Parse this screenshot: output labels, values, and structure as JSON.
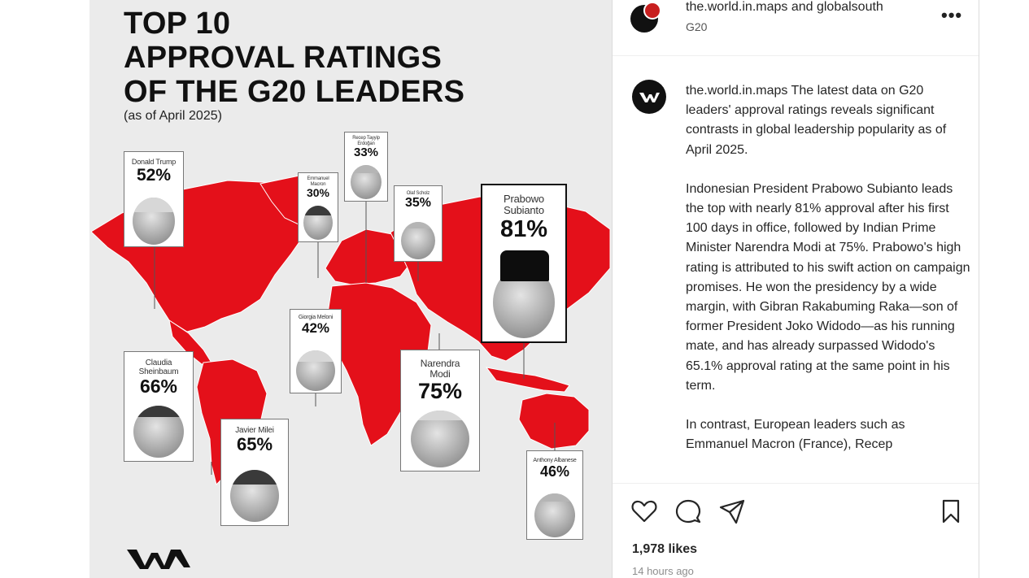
{
  "post": {
    "title_lines": [
      "TOP 10",
      "APPROVAL RATINGS",
      "OF THE G20 LEADERS"
    ],
    "subtitle": "(as of April 2025)",
    "map_color": "#e4101a",
    "leaders": [
      {
        "name": "Donald Trump",
        "pct": "52%"
      },
      {
        "name": "Emmanuel Macron",
        "pct": "30%"
      },
      {
        "name": "Recep Tayyip Erdoğan",
        "pct": "33%"
      },
      {
        "name": "Olaf Scholz",
        "pct": "35%"
      },
      {
        "name": "Prabowo Subianto",
        "pct": "81%"
      },
      {
        "name": "Giorgia Meloni",
        "pct": "42%"
      },
      {
        "name": "Claudia Sheinbaum",
        "pct": "66%"
      },
      {
        "name": "Narendra Modi",
        "pct": "75%"
      },
      {
        "name": "Javier Milei",
        "pct": "65%"
      },
      {
        "name": "Anthony Albanese",
        "pct": "46%"
      }
    ]
  },
  "header": {
    "handle": "the.world.in.maps and globalsouth",
    "subline": "G20",
    "more_icon": "more-horizontal-icon"
  },
  "caption": {
    "username": "the.world.in.maps",
    "paragraph_1": "The latest data on G20 leaders' approval ratings reveals significant contrasts in global leadership popularity as of April 2025.",
    "paragraph_2": "Indonesian President Prabowo Subianto leads the top with nearly 81% approval after his first 100 days in office, followed by Indian Prime Minister Narendra Modi at 75%. Prabowo's high rating is attributed to his swift action on campaign promises. He won the presidency by a wide margin, with Gibran Rakabuming Raka—son of former President Joko Widodo—as his running mate, and has already surpassed Widodo's 65.1% approval rating at the same point in his term.",
    "paragraph_3": "In contrast, European leaders such as Emmanuel Macron (France), Recep"
  },
  "actions": {
    "icons": [
      "heart-icon",
      "comment-icon",
      "share-icon",
      "bookmark-icon"
    ]
  },
  "stats": {
    "likes": "1,978 likes",
    "time": "14 hours ago"
  }
}
